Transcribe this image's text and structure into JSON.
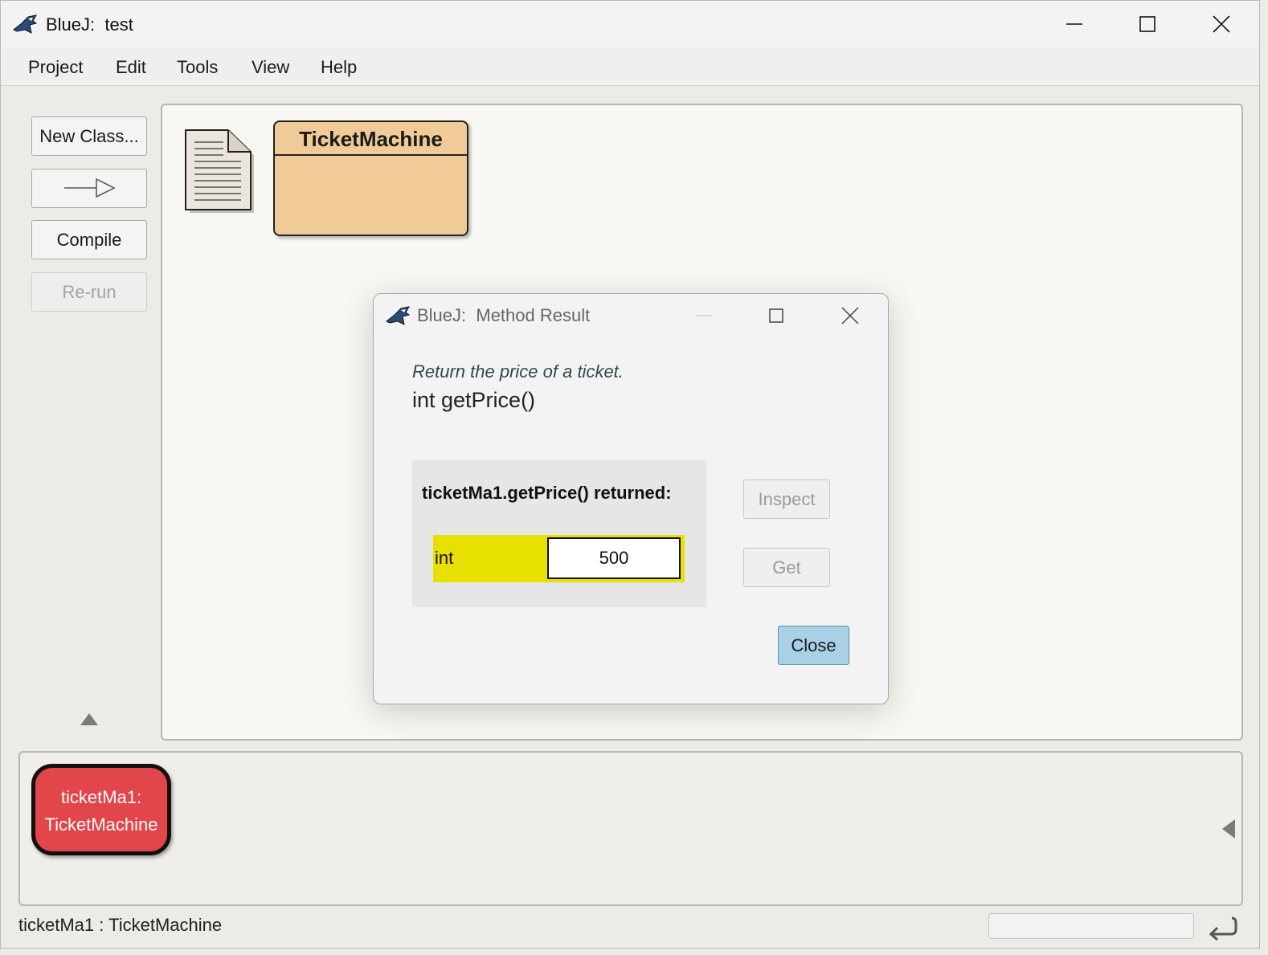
{
  "window": {
    "title": "BlueJ:  test",
    "controls": [
      "minimize-icon",
      "maximize-icon",
      "close-icon"
    ]
  },
  "menubar": {
    "items": [
      "Project",
      "Edit",
      "Tools",
      "View",
      "Help"
    ]
  },
  "sidebar": {
    "new_class": "New Class...",
    "compile": "Compile",
    "rerun": "Re-run"
  },
  "diagram": {
    "class_name": "TicketMachine",
    "readme_icon": "document-icon"
  },
  "object_bench": {
    "object_line1": "ticketMa1:",
    "object_line2": "TicketMachine",
    "object_color": "#e2454a"
  },
  "status": {
    "text": "ticketMa1 : TicketMachine"
  },
  "dialog": {
    "title": "BlueJ:  Method Result",
    "comment": "Return the price of a ticket.",
    "signature": "int getPrice()",
    "result_label": "ticketMa1.getPrice() returned:",
    "result_type": "int",
    "result_value": "500",
    "inspect": "Inspect",
    "get": "Get",
    "close": "Close",
    "accent_color": "#a9d1e6",
    "result_highlight": "#e7e000"
  }
}
